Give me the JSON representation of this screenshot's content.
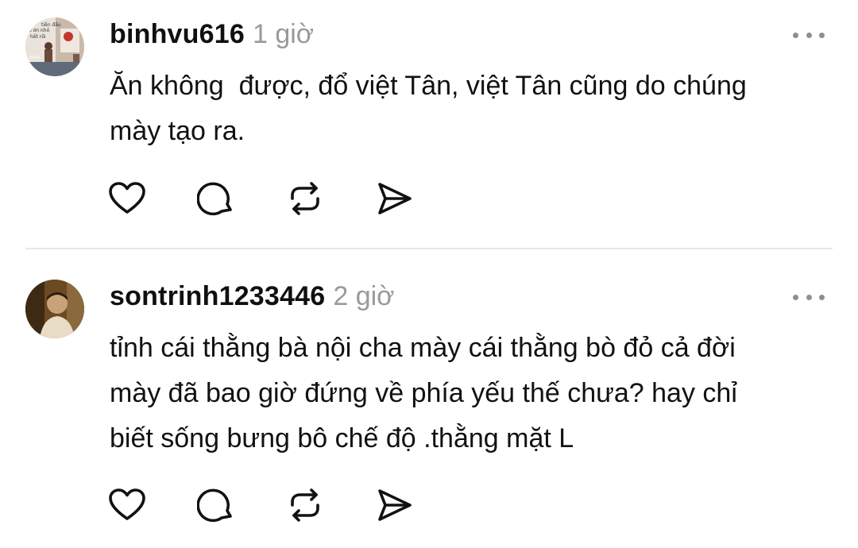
{
  "comments": [
    {
      "username": "binhvu616",
      "time": "1 giờ",
      "text": "Ăn không  được, đổ việt Tân, việt Tân cũng do chúng\nmày tạo ra.",
      "avatar_text": [
        "tiền đầu",
        "ô ơn nhỏ",
        "hết rồi",
        "Mưa"
      ]
    },
    {
      "username": "sontrinh1233446",
      "time": "2 giờ",
      "text": "tỉnh cái thằng bà nội cha mày cái thằng bò đỏ cả đời\nmày đã bao giờ đứng về phía yếu thế chưa? hay chỉ\nbiết sống bưng bô chế độ .thằng mặt L"
    }
  ],
  "icons": {
    "more": "more-horizontal-icon",
    "like": "heart-icon",
    "reply": "speech-bubble-icon",
    "repost": "repost-icon",
    "share": "send-icon"
  },
  "colors": {
    "text": "#101010",
    "muted": "#9a9a9a",
    "divider": "#e6e6e6"
  }
}
